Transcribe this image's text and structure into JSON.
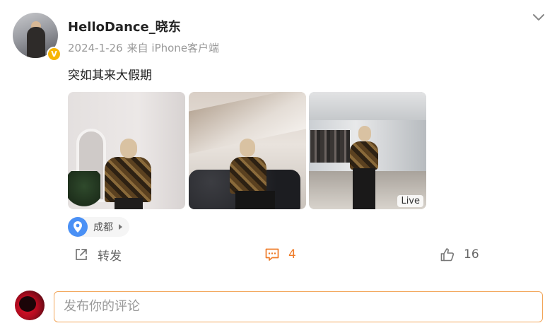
{
  "post": {
    "username": "HelloDance_晓东",
    "date": "2024-1-26",
    "source": "来自 iPhone客户端",
    "text": "突如其来大假期",
    "verified_badge": "V",
    "photos": [
      {
        "name": "photo-mirror",
        "live": false
      },
      {
        "name": "photo-sofa",
        "live": false
      },
      {
        "name": "photo-store",
        "live": true,
        "live_label": "Live"
      }
    ],
    "location": {
      "label": "成都",
      "icon": "location-pin-icon"
    }
  },
  "actions": {
    "repost_label": "转发",
    "comment_count": "4",
    "like_count": "16"
  },
  "comment_box": {
    "placeholder": "发布你的评论"
  },
  "colors": {
    "accent_orange": "#ef7c2a",
    "input_border": "#f2a65a",
    "pin_blue": "#4a90f5",
    "badge_yellow": "#f7b500"
  }
}
